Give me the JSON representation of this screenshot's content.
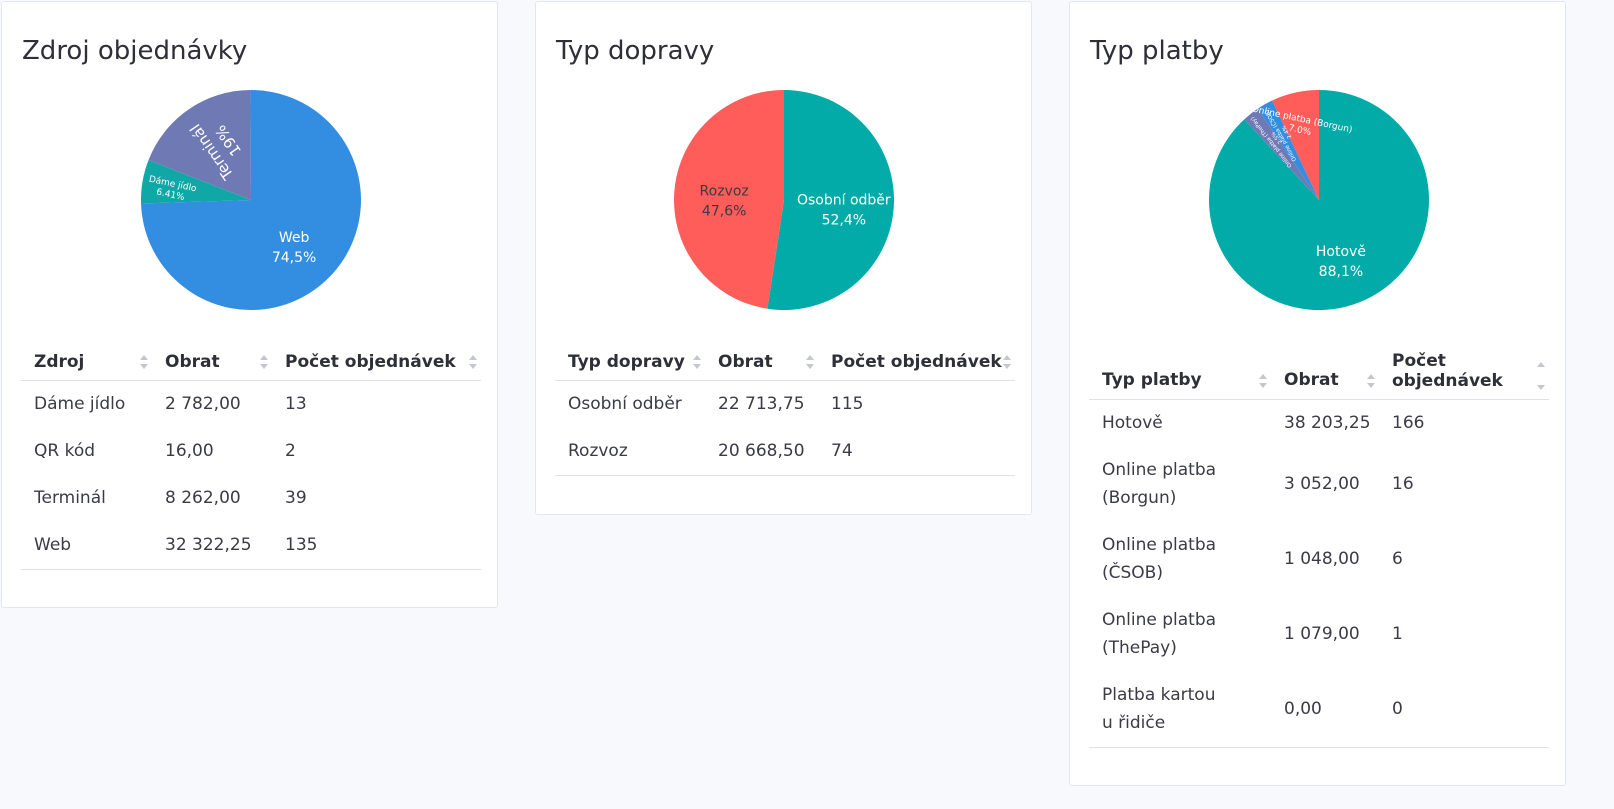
{
  "cards": [
    {
      "title": "Zdroj objednávky",
      "chart_data": {
        "type": "pie",
        "slices": [
          {
            "label": "Web",
            "value": 74.5,
            "display": "74,5%",
            "color": "#338de1"
          },
          {
            "label": "Dáme jídlo",
            "value": 6.41,
            "display": "6.41%",
            "color": "#0fa8a6"
          },
          {
            "label": "Terminál",
            "value": 19,
            "display": "19%",
            "color": "#6f7ab5"
          },
          {
            "label": "QR kód",
            "value": 0.09,
            "display": "",
            "color": "#338de1"
          }
        ]
      },
      "table": {
        "headers": [
          "Zdroj",
          "Obrat",
          "Počet objednávek"
        ],
        "rows": [
          [
            "Dáme jídlo",
            "2 782,00",
            "13"
          ],
          [
            "QR kód",
            "16,00",
            "2"
          ],
          [
            "Terminál",
            "8 262,00",
            "39"
          ],
          [
            "Web",
            "32 322,25",
            "135"
          ]
        ]
      }
    },
    {
      "title": "Typ dopravy",
      "chart_data": {
        "type": "pie",
        "slices": [
          {
            "label": "Osobní odběr",
            "value": 52.4,
            "display": "52,4%",
            "color": "#02aaa8"
          },
          {
            "label": "Rozvoz",
            "value": 47.6,
            "display": "47,6%",
            "color": "#fe5d5a"
          }
        ]
      },
      "table": {
        "headers": [
          "Typ dopravy",
          "Obrat",
          "Počet objednávek"
        ],
        "rows": [
          [
            "Osobní odběr",
            "22 713,75",
            "115"
          ],
          [
            "Rozvoz",
            "20 668,50",
            "74"
          ]
        ]
      }
    },
    {
      "title": "Typ platby",
      "chart_data": {
        "type": "pie",
        "slices": [
          {
            "label": "Hotově",
            "value": 88.1,
            "display": "88,1%",
            "color": "#02aaa8"
          },
          {
            "label": "Online platba (ThePay)",
            "value": 2.5,
            "display": "2.5%",
            "color": "#6f7ab5"
          },
          {
            "label": "Online platba (ČSOB)",
            "value": 2.4,
            "display": "2.4%",
            "color": "#338de1"
          },
          {
            "label": "Online platba (Borgun)",
            "value": 7.0,
            "display": "7.0%",
            "color": "#fe5d5a"
          }
        ]
      },
      "table": {
        "headers": [
          "Typ platby",
          "Obrat",
          "Počet objednávek"
        ],
        "rows": [
          [
            "Hotově",
            "38 203,25",
            "166"
          ],
          [
            "Online platba (Borgun)",
            "3 052,00",
            "16"
          ],
          [
            "Online platba (ČSOB)",
            "1 048,00",
            "6"
          ],
          [
            "Online platba (ThePay)",
            "1 079,00",
            "1"
          ],
          [
            "Platba kartou u řidiče",
            "0,00",
            "0"
          ]
        ]
      }
    }
  ]
}
